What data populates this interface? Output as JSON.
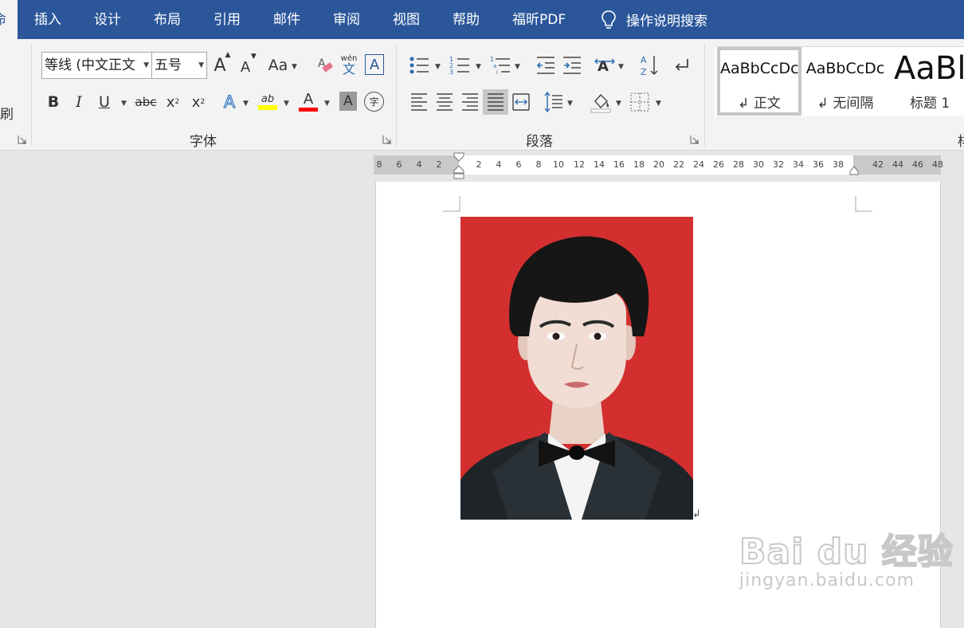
{
  "tabs": {
    "home_fragment": "命",
    "insert": "插入",
    "design": "设计",
    "layout": "布局",
    "references": "引用",
    "mailings": "邮件",
    "review": "审阅",
    "view": "视图",
    "help": "帮助",
    "foxit_pdf": "福昕PDF",
    "tell_me": "操作说明搜索"
  },
  "clipboard": {
    "format_painter_fragment": "刷"
  },
  "font_group": {
    "label": "字体",
    "font_name": "等线 (中文正文",
    "font_size": "五号",
    "change_case": "Aa",
    "phonetic_top": "wén",
    "phonetic_bottom": "文",
    "char_border": "A",
    "bold": "B",
    "italic": "I",
    "underline": "U",
    "strikethrough": "abc",
    "subscript": "x",
    "superscript": "x",
    "text_effect": "A",
    "highlight": "ab",
    "font_color": "A",
    "char_shading": "A",
    "enclose_char": "字",
    "highlight_color": "#ffff00",
    "font_color_value": "#ff0000"
  },
  "paragraph_group": {
    "label": "段落"
  },
  "styles_group": {
    "items": [
      {
        "preview": "AaBbCcDc",
        "name": "↲ 正文"
      },
      {
        "preview": "AaBbCcDc",
        "name": "↲ 无间隔"
      },
      {
        "preview": "AaBl",
        "name": "标题 1"
      }
    ],
    "label_fragment": "样"
  },
  "ruler": {
    "left_ticks": [
      "8",
      "6",
      "4",
      "2"
    ],
    "right_ticks": [
      "2",
      "4",
      "6",
      "8",
      "10",
      "12",
      "14",
      "16",
      "18",
      "20",
      "22",
      "24",
      "26",
      "28",
      "30",
      "32",
      "34",
      "36",
      "38"
    ],
    "margin_ticks": [
      "42",
      "44",
      "46",
      "48"
    ]
  },
  "document": {
    "photo_background": "#d32f2f",
    "paragraph_mark": "↲"
  },
  "watermark": {
    "logo": "Bai du 经验",
    "url": "jingyan.baidu.com"
  }
}
